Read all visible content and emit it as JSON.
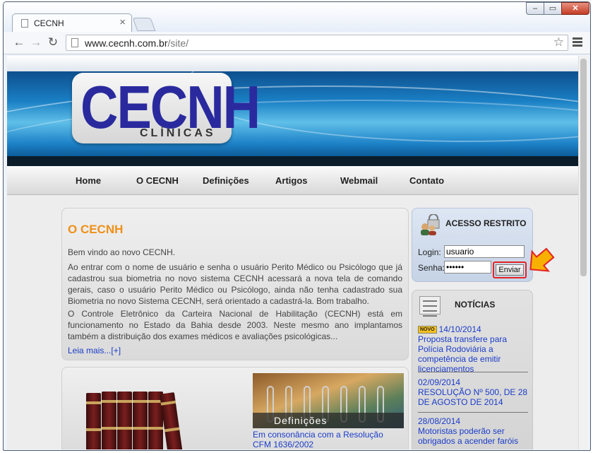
{
  "browser": {
    "tab_title": "CECNH",
    "url_host": "www.cecnh.com.br",
    "url_path": "/site/",
    "close_glyph": "×",
    "window_buttons": {
      "minimize": "–",
      "maximize": "▭",
      "close": "✕"
    },
    "nav_glyphs": {
      "back": "←",
      "forward": "→",
      "reload": "↻",
      "star": "☆"
    }
  },
  "site": {
    "logo_text": "CECNH",
    "logo_subtext": "CLÍNICAS",
    "nav": [
      "Home",
      "O CECNH",
      "Definições",
      "Artigos",
      "Webmail",
      "Contato"
    ],
    "intro": {
      "title": "O CECNH",
      "welcome": "Bem vindo ao novo CECNH.",
      "p1": "Ao entrar com o nome de usuário e senha o usuário Perito Médico ou Psicólogo que já cadastrou sua biometria no novo sistema CECNH acessará a nova tela de comando gerais, caso o usuário Perito Médico ou Psicólogo, ainda não tenha cadastrado sua Biometria no novo Sistema CECNH, será orientado a cadastrá-la. Bom trabalho.",
      "p2": "O Controle Eletrônico da Carteira Nacional de Habilitação (CECNH) está em funcionamento no Estado da Bahia desde 2003. Neste mesmo ano implantamos também a distribuição dos exames médicos e avaliações psicológicas...",
      "read_more": "Leia mais...[+]"
    },
    "definitions": {
      "caption": "Definições",
      "link": "Em consonância com a Resolução CFM 1636/2002"
    },
    "login": {
      "heading": "ACESSO RESTRITO",
      "login_label": "Login:",
      "login_value": "usuario",
      "password_label": "Senha:",
      "password_value": "••••••",
      "submit": "Enviar"
    },
    "news": {
      "heading": "NOTÍCIAS",
      "badge": "NOVO",
      "items": [
        {
          "date": "14/10/2014",
          "text": "Proposta transfere para Polícia Rodoviária a competência de emitir licenciamentos"
        },
        {
          "date": "02/09/2014",
          "text": "RESOLUÇÃO Nº 500, DE 28 DE AGOSTO DE 2014"
        },
        {
          "date": "28/08/2014",
          "text": "Motoristas poderão ser obrigados a acender faróis"
        }
      ]
    }
  },
  "colors": {
    "accent_orange": "#f09018",
    "link_blue": "#1a3cc8",
    "logo_blue": "#2a2a9e",
    "highlight_red": "#e52222"
  }
}
